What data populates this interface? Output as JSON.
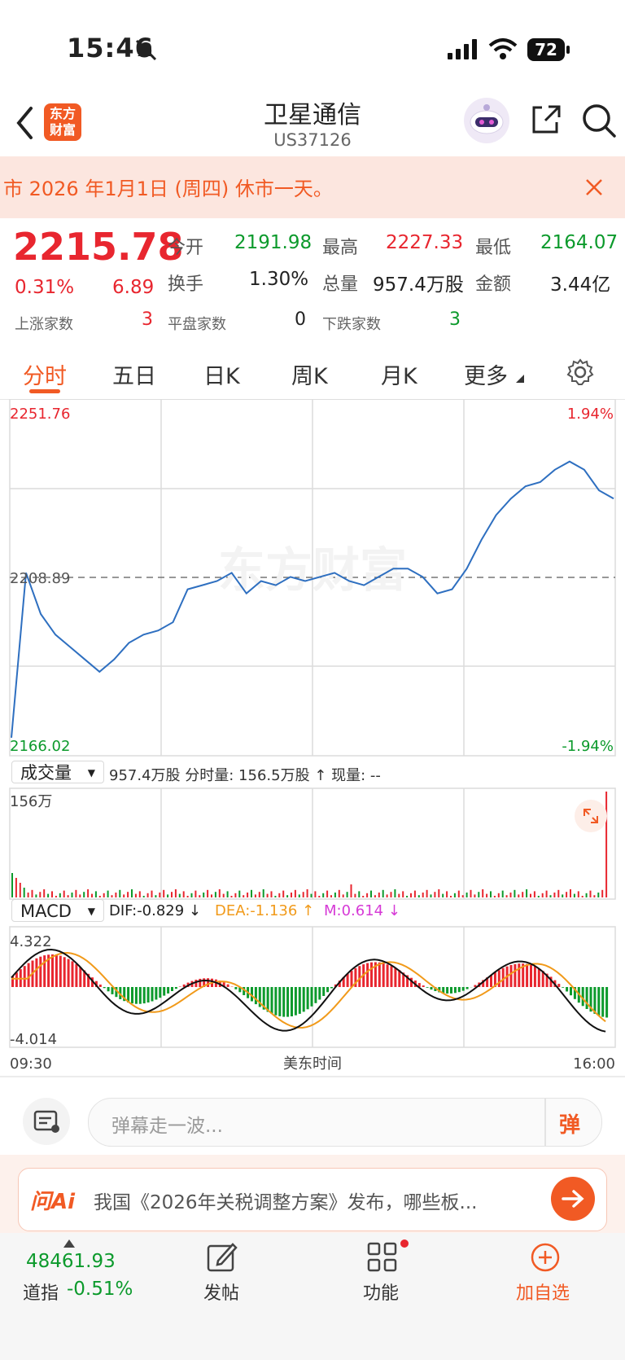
{
  "status_bar": {
    "time": "15:46",
    "battery": "72"
  },
  "header": {
    "title": "卫星通信",
    "code": "US37126",
    "logo_line1": "东方",
    "logo_line2": "财富"
  },
  "notice": {
    "text": "市 2026 年1月1日 (周四) 休市一天。"
  },
  "quote": {
    "price": "2215.78",
    "change_pct": "0.31%",
    "change": "6.89",
    "up_label": "上涨家数",
    "up_count": "3",
    "flat_label": "平盘家数",
    "flat_count": "0",
    "down_label": "下跌家数",
    "down_count": "3",
    "open_label": "今开",
    "open": "2191.98",
    "high_label": "最高",
    "high": "2227.33",
    "low_label": "最低",
    "low": "2164.07",
    "turnover_label": "换手",
    "turnover": "1.30%",
    "volume_label": "总量",
    "volume": "957.4万股",
    "amount_label": "金额",
    "amount": "3.44亿"
  },
  "tabs": [
    "分时",
    "五日",
    "日K",
    "周K",
    "月K",
    "更多"
  ],
  "chart": {
    "price_high": "2251.76",
    "price_mid": "2208.89",
    "price_low": "2166.02",
    "pct_high": "1.94%",
    "pct_low": "-1.94%",
    "watermark": "东方财富",
    "volume_select": "成交量",
    "volume_info": "957.4万股 分时量: 156.5万股 ↑ 现量: --",
    "volume_max": "156万",
    "macd_select": "MACD",
    "dif": "DIF:-0.829 ↓",
    "dea": "DEA:-1.136 ↑",
    "m": "M:0.614 ↓",
    "macd_high": "4.322",
    "macd_low": "-4.014",
    "time_start": "09:30",
    "time_mid": "美东时间",
    "time_end": "16:00"
  },
  "chart_data": {
    "type": "line",
    "title": "",
    "ylim": [
      2166.02,
      2251.76
    ],
    "reference": 2208.89,
    "x": [
      "09:30",
      "16:00"
    ],
    "series": [
      {
        "values": [
          2170,
          2210,
          2200,
          2195,
          2192,
          2189,
          2186,
          2189,
          2193,
          2195,
          2196,
          2198,
          2206,
          2207,
          2208,
          2210,
          2205,
          2208,
          2207,
          2209,
          2208,
          2209,
          2210,
          2208,
          2207,
          2209,
          2211,
          2211,
          2209,
          2205,
          2206,
          2211,
          2218,
          2224,
          2228,
          2231,
          2232,
          2235,
          2237,
          2235,
          2230,
          2228
        ]
      }
    ],
    "volume_max": 156,
    "macd_range": [
      -4.014,
      4.322
    ]
  },
  "danmu": {
    "placeholder": "弹幕走一波...",
    "button": "弹"
  },
  "ai_banner": {
    "brand": "问Ai",
    "text": "我国《2026年关税调整方案》发布，哪些板..."
  },
  "bottom_bar": {
    "index_value": "48461.93",
    "index_name": "道指",
    "index_change": "-0.51%",
    "post_label": "发帖",
    "func_label": "功能",
    "add_label": "加自选"
  }
}
